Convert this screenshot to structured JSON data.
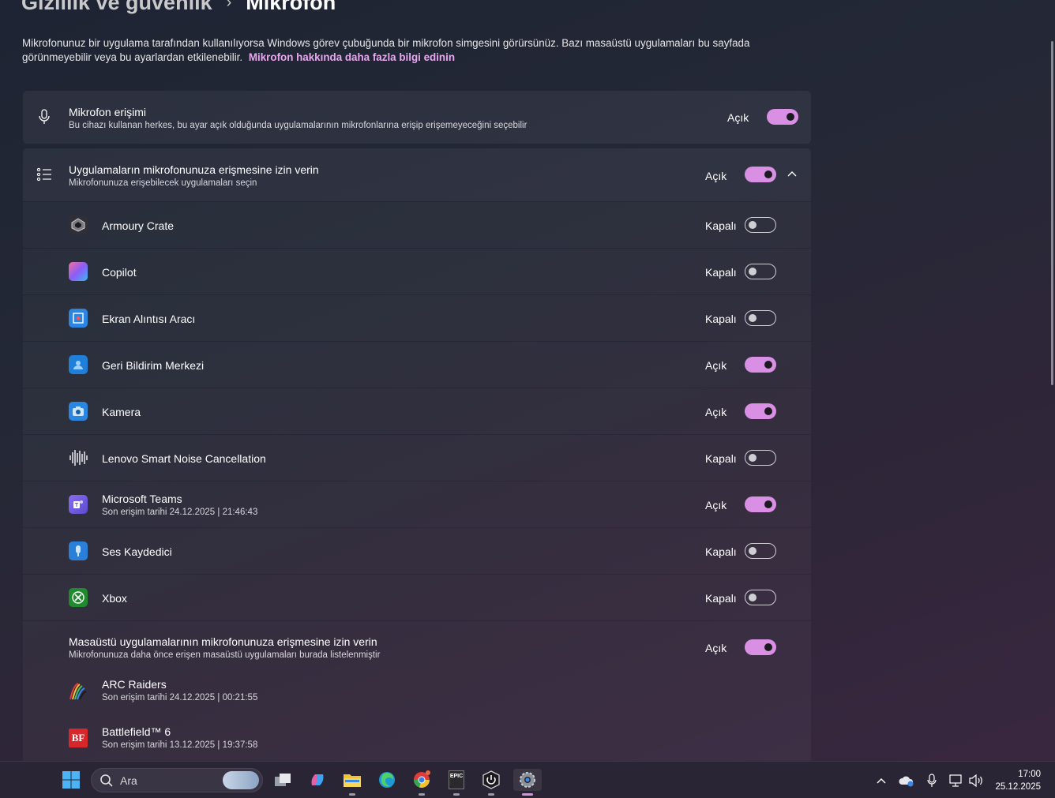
{
  "breadcrumb": {
    "parent": "Gizlilik ve güvenlik",
    "separator": "›",
    "current": "Mikrofon"
  },
  "description": {
    "text": "Mikrofonunuz bir uygulama tarafından kullanılıyorsa Windows görev çubuğunda bir mikrofon simgesini görürsünüz. Bazı masaüstü uygulamaları bu sayfada görünmeyebilir veya bu ayarlardan etkilenebilir.",
    "link": "Mikrofon hakkında daha fazla bilgi edinin"
  },
  "mic_access": {
    "title": "Mikrofon erişimi",
    "subtitle": "Bu cihazı kullanan herkes, bu ayar açık olduğunda uygulamalarının mikrofonlarına erişip erişemeyeceğini seçebilir",
    "state": "Açık",
    "on": true
  },
  "apps_access": {
    "title": "Uygulamaların mikrofonunuza erişmesine izin verin",
    "subtitle": "Mikrofonunuza erişebilecek uygulamaları seçin",
    "state": "Açık",
    "on": true
  },
  "apps": [
    {
      "name": "Armoury Crate",
      "sub": "",
      "state": "Kapalı",
      "on": false,
      "icon": "armoury-crate-icon",
      "color": "#3a3a3f"
    },
    {
      "name": "Copilot",
      "sub": "",
      "state": "Kapalı",
      "on": false,
      "icon": "copilot-icon",
      "color": "#7b5cf0"
    },
    {
      "name": "Ekran Alıntısı Aracı",
      "sub": "",
      "state": "Kapalı",
      "on": false,
      "icon": "snipping-tool-icon",
      "color": "#2a86e0"
    },
    {
      "name": "Geri Bildirim Merkezi",
      "sub": "",
      "state": "Açık",
      "on": true,
      "icon": "feedback-hub-icon",
      "color": "#1f7fd9"
    },
    {
      "name": "Kamera",
      "sub": "",
      "state": "Açık",
      "on": true,
      "icon": "camera-icon",
      "color": "#2a86e0"
    },
    {
      "name": "Lenovo Smart Noise Cancellation",
      "sub": "",
      "state": "Kapalı",
      "on": false,
      "icon": "lenovo-noise-icon",
      "color": "#1e2433"
    },
    {
      "name": "Microsoft Teams",
      "sub": "Son erişim tarihi 24.12.2025  |  21:46:43",
      "state": "Açık",
      "on": true,
      "icon": "teams-icon",
      "color": "#7b63d9"
    },
    {
      "name": "Ses Kaydedici",
      "sub": "",
      "state": "Kapalı",
      "on": false,
      "icon": "sound-recorder-icon",
      "color": "#2a7fd8"
    },
    {
      "name": "Xbox",
      "sub": "",
      "state": "Kapalı",
      "on": false,
      "icon": "xbox-icon",
      "color": "#1f8a2e"
    }
  ],
  "desktop_access": {
    "title": "Masaüstü uygulamalarının mikrofonunuza erişmesine izin verin",
    "subtitle": "Mikrofonunuza daha önce erişen masaüstü uygulamaları burada listelenmiştir",
    "state": "Açık",
    "on": true,
    "apps": [
      {
        "name": "ARC Raiders",
        "sub": "Son erişim tarihi 24.12.2025  |  00:21:55",
        "icon": "arc-raiders-icon"
      },
      {
        "name": "Battlefield™ 6",
        "sub": "Son erişim tarihi 13.12.2025  |  19:37:58",
        "icon": "battlefield-icon",
        "icon_text": "BF"
      }
    ]
  },
  "taskbar": {
    "search_placeholder": "Ara",
    "time": "17:00",
    "date": "25.12.2025",
    "epic_text": "EPIC"
  },
  "colors": {
    "accent": "#d990e4",
    "link": "#e7a8f0"
  }
}
